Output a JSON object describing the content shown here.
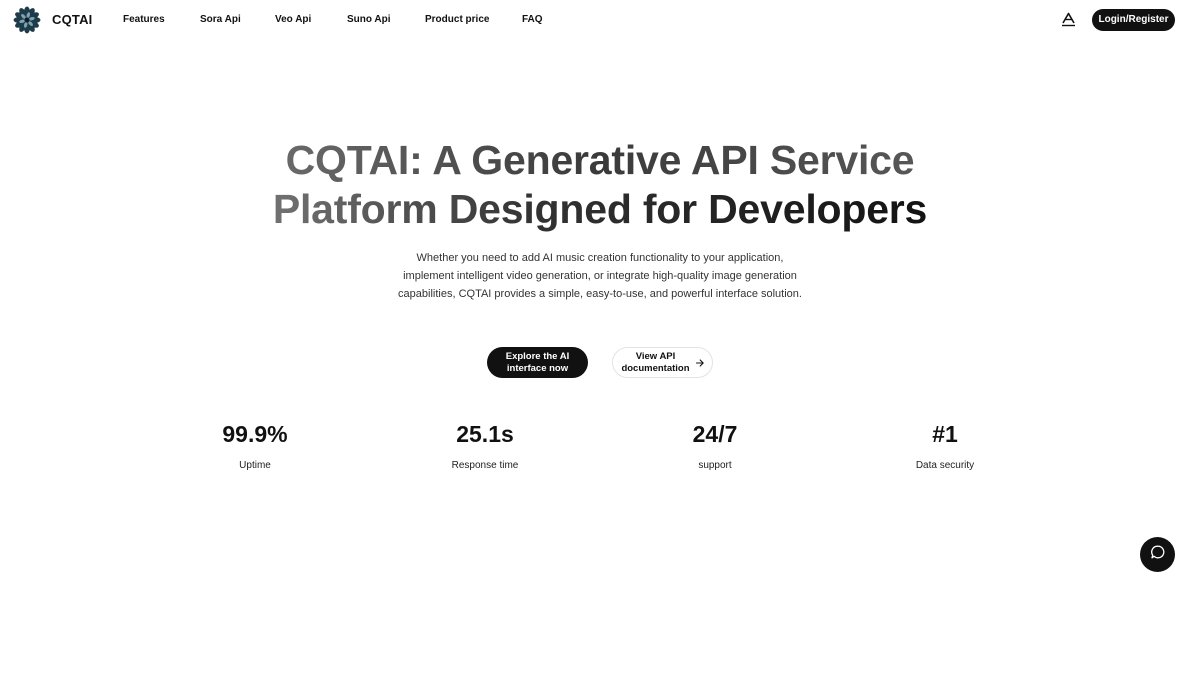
{
  "header": {
    "brand": "CQTAI",
    "logo_icon": "flower-logo-icon",
    "nav": [
      {
        "label": "Features"
      },
      {
        "label": "Sora Api"
      },
      {
        "label": "Veo Api"
      },
      {
        "label": "Suno Api"
      },
      {
        "label": "Product price"
      },
      {
        "label": "FAQ"
      }
    ],
    "language_icon": "translate-icon",
    "login_label": "Login/Register"
  },
  "hero": {
    "title_line1": "CQTAI: A Generative API Service",
    "title_line2": "Platform Designed for Developers",
    "description": "Whether you need to add AI music creation functionality to your application, implement intelligent video generation, or integrate high-quality image generation capabilities, CQTAI provides a simple, easy-to-use, and powerful interface solution.",
    "primary_button": "Explore the AI interface now",
    "secondary_button": "View API documentation",
    "secondary_icon": "arrow-right-icon"
  },
  "stats": [
    {
      "value": "99.9%",
      "label": "Uptime"
    },
    {
      "value": "25.1s",
      "label": "Response time"
    },
    {
      "value": "24/7",
      "label": "support"
    },
    {
      "value": "#1",
      "label": "Data security"
    }
  ],
  "chat": {
    "icon": "chat-bubble-icon"
  },
  "colors": {
    "accent": "#111111",
    "background": "#ffffff"
  }
}
